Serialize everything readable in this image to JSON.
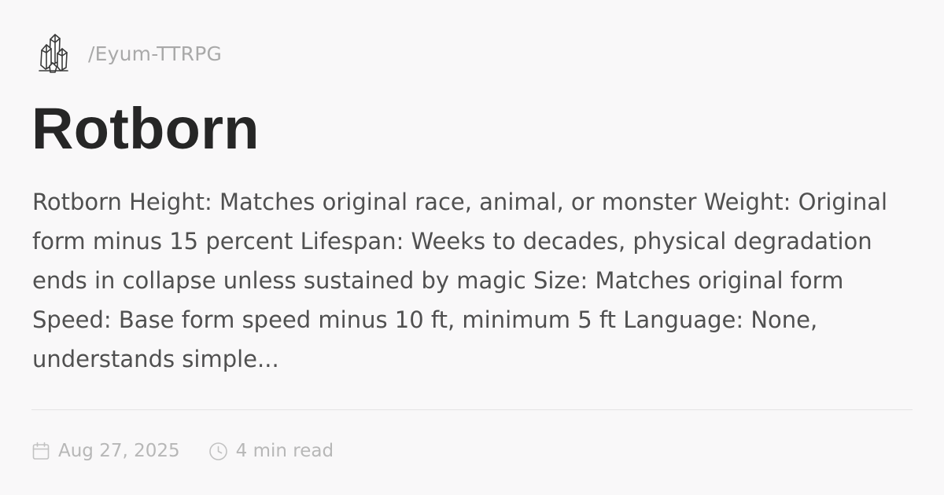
{
  "header": {
    "logo_icon": "crystal-cluster-icon",
    "site_path": "/Eyum-TTRPG"
  },
  "article": {
    "title": "Rotborn",
    "excerpt": "Rotborn Height: Matches original race, animal, or monster Weight: Original form minus 15 percent Lifespan: Weeks to decades, physical degradation ends in collapse unless sustained by magic Size: Matches original form Speed: Base form speed minus 10 ft, minimum 5 ft Language: None, understands simple..."
  },
  "meta": {
    "date_icon": "calendar-icon",
    "date": "Aug 27, 2025",
    "reading_icon": "clock-icon",
    "reading_time": "4 min read"
  },
  "colors": {
    "background": "#f9f8f9",
    "title": "#262626",
    "body_text": "#505050",
    "muted": "#a9a9a9",
    "divider": "#e4e3e4"
  }
}
